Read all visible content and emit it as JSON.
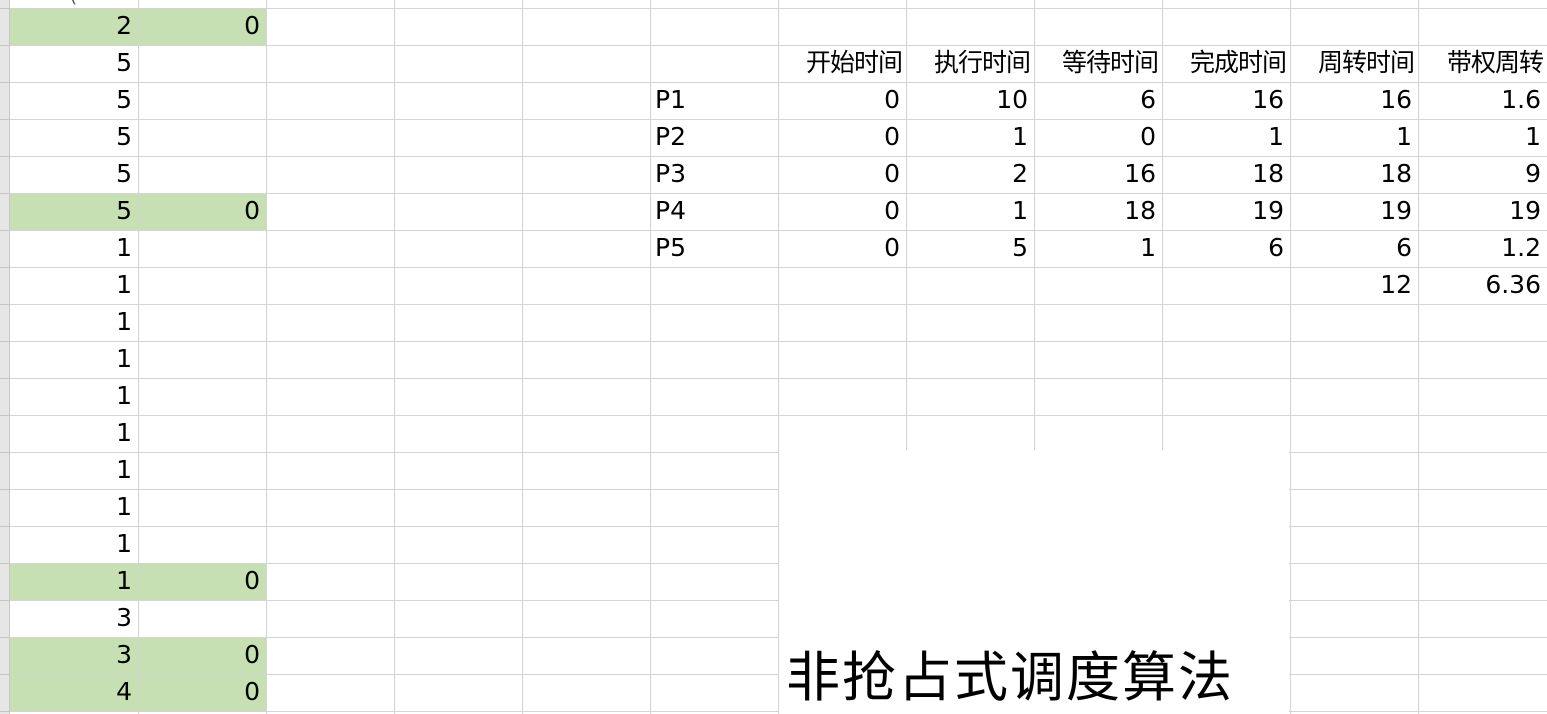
{
  "left_col_b": [
    "2",
    "5",
    "5",
    "5",
    "5",
    "5",
    "1",
    "1",
    "1",
    "1",
    "1",
    "1",
    "1",
    "1",
    "1",
    "1",
    "3",
    "3",
    "4"
  ],
  "left_col_c": {
    "0": "0",
    "5": "0",
    "15": "0",
    "17": "0",
    "18": "0"
  },
  "table": {
    "headers": [
      "开始时间",
      "执行时间",
      "等待时间",
      "完成时间",
      "周转时间",
      "带权周转"
    ],
    "rows": [
      {
        "name": "P1",
        "values": [
          "0",
          "10",
          "6",
          "16",
          "16",
          "1.6"
        ]
      },
      {
        "name": "P2",
        "values": [
          "0",
          "1",
          "0",
          "1",
          "1",
          "1"
        ]
      },
      {
        "name": "P3",
        "values": [
          "0",
          "2",
          "16",
          "18",
          "18",
          "9"
        ]
      },
      {
        "name": "P4",
        "values": [
          "0",
          "1",
          "18",
          "19",
          "19",
          "19"
        ]
      },
      {
        "name": "P5",
        "values": [
          "0",
          "5",
          "1",
          "6",
          "6",
          "1.2"
        ]
      }
    ],
    "averages": {
      "turnaround": "12",
      "weighted": "6.36"
    }
  },
  "chart": {
    "title": "非抢占式调度算法"
  },
  "colors": {
    "highlight": "#c6e0b4",
    "gridline": "#d4d4d4"
  }
}
